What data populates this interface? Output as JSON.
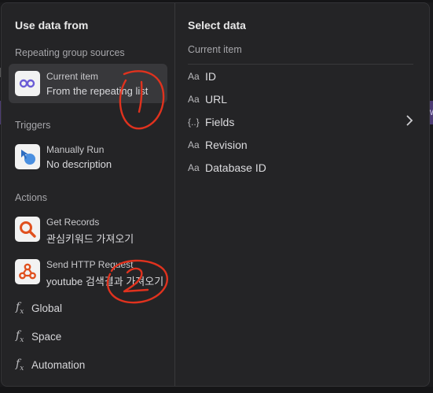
{
  "left": {
    "heading": "Use data from",
    "sections": {
      "repeating": "Repeating group sources",
      "triggers": "Triggers",
      "actions": "Actions"
    },
    "current_item": {
      "title": "Current item",
      "subtitle": "From the repeating list"
    },
    "manually_run": {
      "title": "Manually Run",
      "subtitle": "No description"
    },
    "get_records": {
      "title": "Get Records",
      "subtitle": "관심키워드 가져오기"
    },
    "send_http": {
      "title": "Send HTTP Request",
      "subtitle": "youtube 검색결과 가져오기"
    },
    "globals": [
      {
        "label": "Global"
      },
      {
        "label": "Space"
      },
      {
        "label": "Automation"
      }
    ]
  },
  "right": {
    "heading": "Select data",
    "section": "Current item",
    "fields": [
      {
        "type": "Aa",
        "label": "ID"
      },
      {
        "type": "Aa",
        "label": "URL"
      },
      {
        "type": "{..}",
        "label": "Fields"
      },
      {
        "type": "Aa",
        "label": "Revision"
      },
      {
        "type": "Aa",
        "label": "Database ID"
      }
    ]
  },
  "background": {
    "partial_text": "w"
  },
  "annotations": {
    "one": "1",
    "two": "2"
  },
  "colors": {
    "panel": "#242426",
    "selected": "#38383b",
    "annotation": "#e0321e"
  }
}
